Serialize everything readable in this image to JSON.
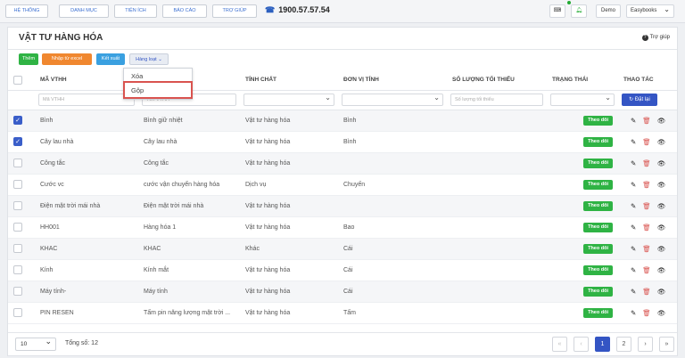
{
  "topbar": {
    "menu": [
      "HỆ THỐNG",
      "DANH MỤC",
      "TIỆN ÍCH",
      "BÁO CÁO",
      "TRỢ GIÚP"
    ],
    "phone": "1900.57.57.54",
    "demo": "Demo",
    "app": "Easybooks"
  },
  "page": {
    "title": "VẬT TƯ HÀNG HÓA",
    "help": "Trợ giúp"
  },
  "actions": {
    "add": "Thêm",
    "import": "Nhập từ excel",
    "export": "Kết xuất",
    "bulk": "Hàng loạt"
  },
  "dropdown": {
    "items": [
      "Xóa",
      "Gộp"
    ]
  },
  "table": {
    "headers": [
      "MÃ VTHH",
      "TÊN VTHH",
      "TÍNH CHẤT",
      "ĐƠN VỊ TÍNH",
      "SỐ LƯỢNG TỐI THIỂU",
      "TRẠNG THÁI",
      "THAO TÁC"
    ],
    "filters": {
      "code": "Mã VTHH",
      "name": "Tên VTHH",
      "minqty": "Số lượng tối thiểu",
      "reset": "Đặt lại"
    },
    "rows": [
      {
        "checked": true,
        "code": "Bình",
        "name": "Bình giữ nhiệt",
        "type": "Vật tư hàng hóa",
        "unit": "Bình",
        "status": "Theo dõi"
      },
      {
        "checked": true,
        "code": "Cây lau nhà",
        "name": "Cây lau nhà",
        "type": "Vật tư hàng hóa",
        "unit": "Bình",
        "status": "Theo dõi"
      },
      {
        "checked": false,
        "code": "Công tắc",
        "name": "Công tắc",
        "type": "Vật tư hàng hóa",
        "unit": "",
        "status": "Theo dõi"
      },
      {
        "checked": false,
        "code": "Cước vc",
        "name": "cước vận chuyển hàng hóa",
        "type": "Dịch vụ",
        "unit": "Chuyến",
        "status": "Theo dõi"
      },
      {
        "checked": false,
        "code": "Điện mặt trời mái nhà",
        "name": "Điện mặt trời mái nhà",
        "type": "Vật tư hàng hóa",
        "unit": "",
        "status": "Theo dõi"
      },
      {
        "checked": false,
        "code": "HH001",
        "name": "Hàng hóa 1",
        "type": "Vật tư hàng hóa",
        "unit": "Bao",
        "status": "Theo dõi"
      },
      {
        "checked": false,
        "code": "KHAC",
        "name": "KHAC",
        "type": "Khác",
        "unit": "Cái",
        "status": "Theo dõi"
      },
      {
        "checked": false,
        "code": "Kính",
        "name": "Kính mắt",
        "type": "Vật tư hàng hóa",
        "unit": "Cái",
        "status": "Theo dõi"
      },
      {
        "checked": false,
        "code": "Máy tính-",
        "name": "Máy tính",
        "type": "Vật tư hàng hóa",
        "unit": "Cái",
        "status": "Theo dõi"
      },
      {
        "checked": false,
        "code": "PIN RESEN",
        "name": "Tấm pin năng lượng mặt trời ...",
        "type": "Vật tư hàng hóa",
        "unit": "Tấm",
        "status": "Theo dõi"
      }
    ]
  },
  "footer": {
    "page_size": "10",
    "total": "Tổng số: 12",
    "pages": [
      "1",
      "2"
    ]
  }
}
